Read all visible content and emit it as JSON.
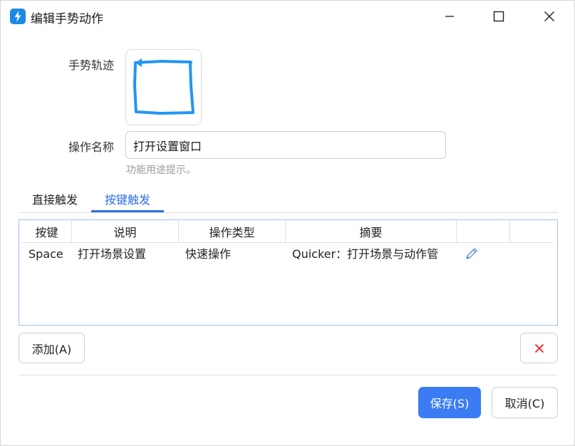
{
  "window": {
    "title": "编辑手势动作",
    "accent_color": "#3b7cf2",
    "icons": [
      "app-lightning-icon",
      "minimize-icon",
      "maximize-icon",
      "close-icon"
    ]
  },
  "form": {
    "gesture_label": "手势轨迹",
    "name_label": "操作名称",
    "name_value": "打开设置窗口",
    "hint": "功能用途提示。"
  },
  "tabs": [
    {
      "label": "直接触发",
      "active": false
    },
    {
      "label": "按键触发",
      "active": true
    }
  ],
  "table": {
    "columns": [
      "按键",
      "说明",
      "操作类型",
      "摘要"
    ],
    "rows": [
      {
        "key": "Space",
        "desc": "打开场景设置",
        "type": "快速操作",
        "summary": "Quicker：打开场景与动作管",
        "action_icon": "pencil-edit-icon"
      }
    ]
  },
  "buttons": {
    "add": "添加(A)",
    "delete_icon": "delete-x-icon",
    "save": "保存(S)",
    "cancel": "取消(C)"
  }
}
